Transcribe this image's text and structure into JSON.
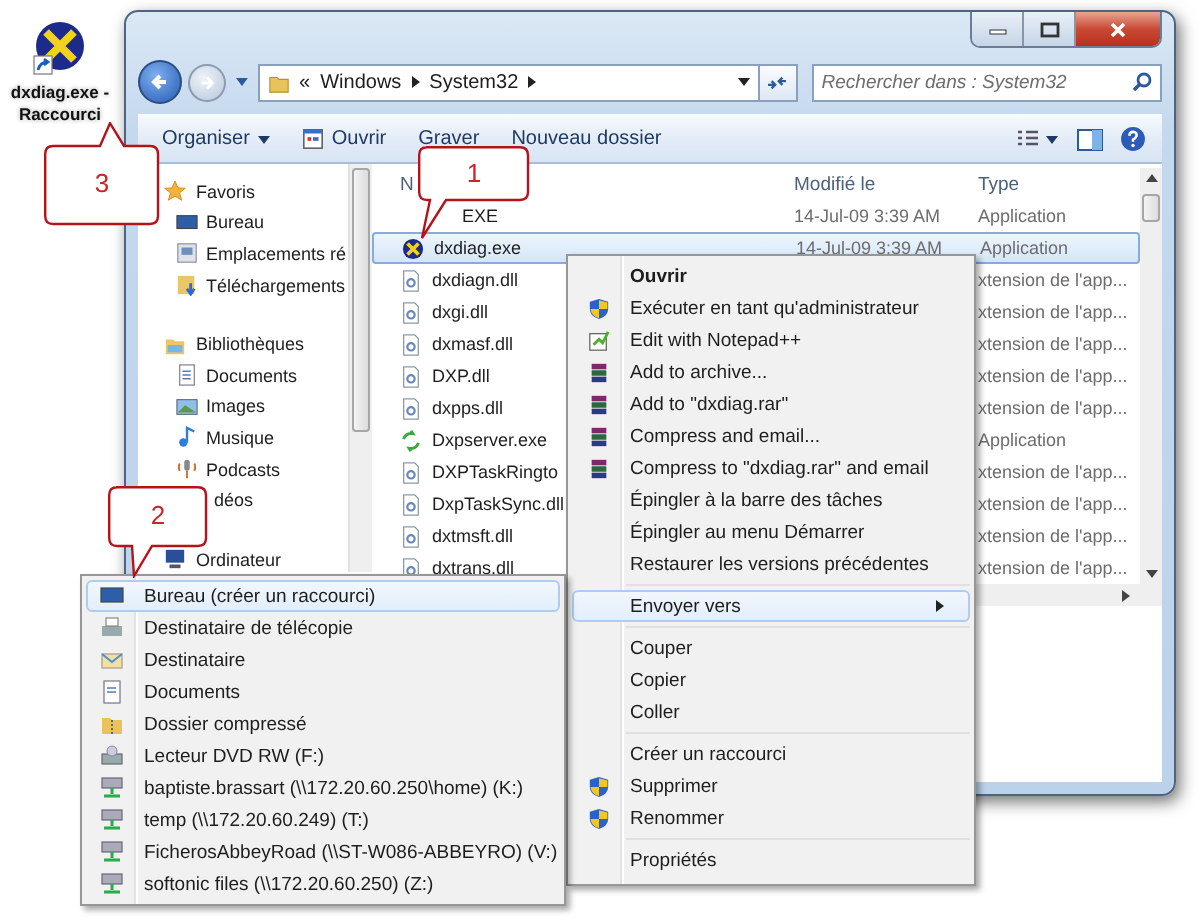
{
  "desktop_shortcut": {
    "label": "dxdiag.exe - Raccourci"
  },
  "callouts": [
    {
      "number": "1"
    },
    {
      "number": "2"
    },
    {
      "number": "3"
    }
  ],
  "explorer": {
    "breadcrumb": {
      "overflow": "«",
      "segments": [
        "Windows",
        "System32"
      ]
    },
    "search": {
      "placeholder": "Rechercher dans : System32"
    },
    "toolbar": [
      {
        "label": "Organiser",
        "kind": "menu"
      },
      {
        "label": "Ouvrir",
        "kind": "icon"
      },
      {
        "label": "Graver",
        "kind": "plain"
      },
      {
        "label": "Nouveau dossier",
        "kind": "plain"
      }
    ],
    "nav": [
      {
        "label": "Favoris",
        "kind": "star",
        "children": [
          {
            "label": "Bureau",
            "kind": "desktop"
          },
          {
            "label": "Emplacements ré",
            "kind": "places"
          },
          {
            "label": "Téléchargements",
            "kind": "downloads"
          }
        ]
      },
      {
        "label": "Bibliothèques",
        "kind": "library",
        "children": [
          {
            "label": "Documents",
            "kind": "documents"
          },
          {
            "label": "Images",
            "kind": "images"
          },
          {
            "label": "Musique",
            "kind": "music"
          },
          {
            "label": "Podcasts",
            "kind": "podcasts"
          },
          {
            "label": "déos",
            "kind": "none"
          }
        ]
      },
      {
        "label": "Ordinateur",
        "kind": "computer"
      }
    ],
    "columns": [
      "N",
      "Modifié le",
      "Type"
    ],
    "files": [
      {
        "name": "EXE",
        "kind": "none",
        "modified": "14-Jul-09 3:39 AM",
        "type": "Application",
        "selected": false
      },
      {
        "name": "dxdiag.exe",
        "kind": "directx",
        "modified": "14-Jul-09 3:39 AM",
        "type": "Application",
        "selected": true
      },
      {
        "name": "dxdiagn.dll",
        "kind": "dll",
        "type": "xtension de l'app...",
        "selected": false
      },
      {
        "name": "dxgi.dll",
        "kind": "dll",
        "type": "xtension de l'app...",
        "selected": false
      },
      {
        "name": "dxmasf.dll",
        "kind": "dll",
        "type": "xtension de l'app...",
        "selected": false
      },
      {
        "name": "DXP.dll",
        "kind": "dll",
        "type": "xtension de l'app...",
        "selected": false
      },
      {
        "name": "dxpps.dll",
        "kind": "dll",
        "type": "xtension de l'app...",
        "selected": false
      },
      {
        "name": "Dxpserver.exe",
        "kind": "sync",
        "type": "Application",
        "selected": false
      },
      {
        "name": "DXPTaskRingto",
        "kind": "dll",
        "type": "xtension de l'app...",
        "selected": false
      },
      {
        "name": "DxpTaskSync.dll",
        "kind": "dll",
        "type": "xtension de l'app...",
        "selected": false
      },
      {
        "name": "dxtmsft.dll",
        "kind": "dll",
        "type": "xtension de l'app...",
        "selected": false
      },
      {
        "name": "dxtrans.dll",
        "kind": "dll",
        "type": "xtension de l'app...",
        "selected": false
      }
    ]
  },
  "context_menu": {
    "groups": [
      [
        {
          "label": "Ouvrir",
          "kind": "none",
          "default": true,
          "selected": false,
          "submenu": false
        },
        {
          "label": "Exécuter en tant qu'administrateur",
          "kind": "shield",
          "default": false,
          "selected": false,
          "submenu": false
        },
        {
          "label": "Edit with Notepad++",
          "kind": "notepad",
          "default": false,
          "selected": false,
          "submenu": false
        },
        {
          "label": "Add to archive...",
          "kind": "archive",
          "default": false,
          "selected": false,
          "submenu": false
        },
        {
          "label": "Add to \"dxdiag.rar\"",
          "kind": "archive",
          "default": false,
          "selected": false,
          "submenu": false
        },
        {
          "label": "Compress and email...",
          "kind": "archive",
          "default": false,
          "selected": false,
          "submenu": false
        },
        {
          "label": "Compress to \"dxdiag.rar\" and email",
          "kind": "archive",
          "default": false,
          "selected": false,
          "submenu": false
        },
        {
          "label": "Épingler à la barre des tâches",
          "kind": "none",
          "default": false,
          "selected": false,
          "submenu": false
        },
        {
          "label": "Épingler au menu Démarrer",
          "kind": "none",
          "default": false,
          "selected": false,
          "submenu": false
        },
        {
          "label": "Restaurer les versions précédentes",
          "kind": "none",
          "default": false,
          "selected": false,
          "submenu": false
        }
      ],
      [
        {
          "label": "Envoyer vers",
          "kind": "none",
          "default": false,
          "selected": true,
          "submenu": true
        }
      ],
      [
        {
          "label": "Couper",
          "kind": "none",
          "default": false,
          "selected": false,
          "submenu": false
        },
        {
          "label": "Copier",
          "kind": "none",
          "default": false,
          "selected": false,
          "submenu": false
        },
        {
          "label": "Coller",
          "kind": "none",
          "default": false,
          "selected": false,
          "submenu": false
        }
      ],
      [
        {
          "label": "Créer un raccourci",
          "kind": "none",
          "default": false,
          "selected": false,
          "submenu": false
        },
        {
          "label": "Supprimer",
          "kind": "shield",
          "default": false,
          "selected": false,
          "submenu": false
        },
        {
          "label": "Renommer",
          "kind": "shield",
          "default": false,
          "selected": false,
          "submenu": false
        }
      ],
      [
        {
          "label": "Propriétés",
          "kind": "none",
          "default": false,
          "selected": false,
          "submenu": false
        }
      ]
    ]
  },
  "send_to_menu": {
    "items": [
      {
        "label": "Bureau (créer un raccourci)",
        "kind": "desktop",
        "selected": true
      },
      {
        "label": "Destinataire de télécopie",
        "kind": "fax",
        "selected": false
      },
      {
        "label": "Destinataire",
        "kind": "mail",
        "selected": false
      },
      {
        "label": "Documents",
        "kind": "document",
        "selected": false
      },
      {
        "label": "Dossier compressé",
        "kind": "zip",
        "selected": false
      },
      {
        "label": "Lecteur DVD RW (F:)",
        "kind": "dvd",
        "selected": false
      },
      {
        "label": "baptiste.brassart (\\\\172.20.60.250\\home) (K:)",
        "kind": "network",
        "selected": false
      },
      {
        "label": "temp (\\\\172.20.60.249) (T:)",
        "kind": "network",
        "selected": false
      },
      {
        "label": "FicherosAbbeyRoad (\\\\ST-W086-ABBEYRO) (V:)",
        "kind": "network",
        "selected": false
      },
      {
        "label": "softonic files (\\\\172.20.60.250) (Z:)",
        "kind": "network",
        "selected": false
      }
    ]
  }
}
